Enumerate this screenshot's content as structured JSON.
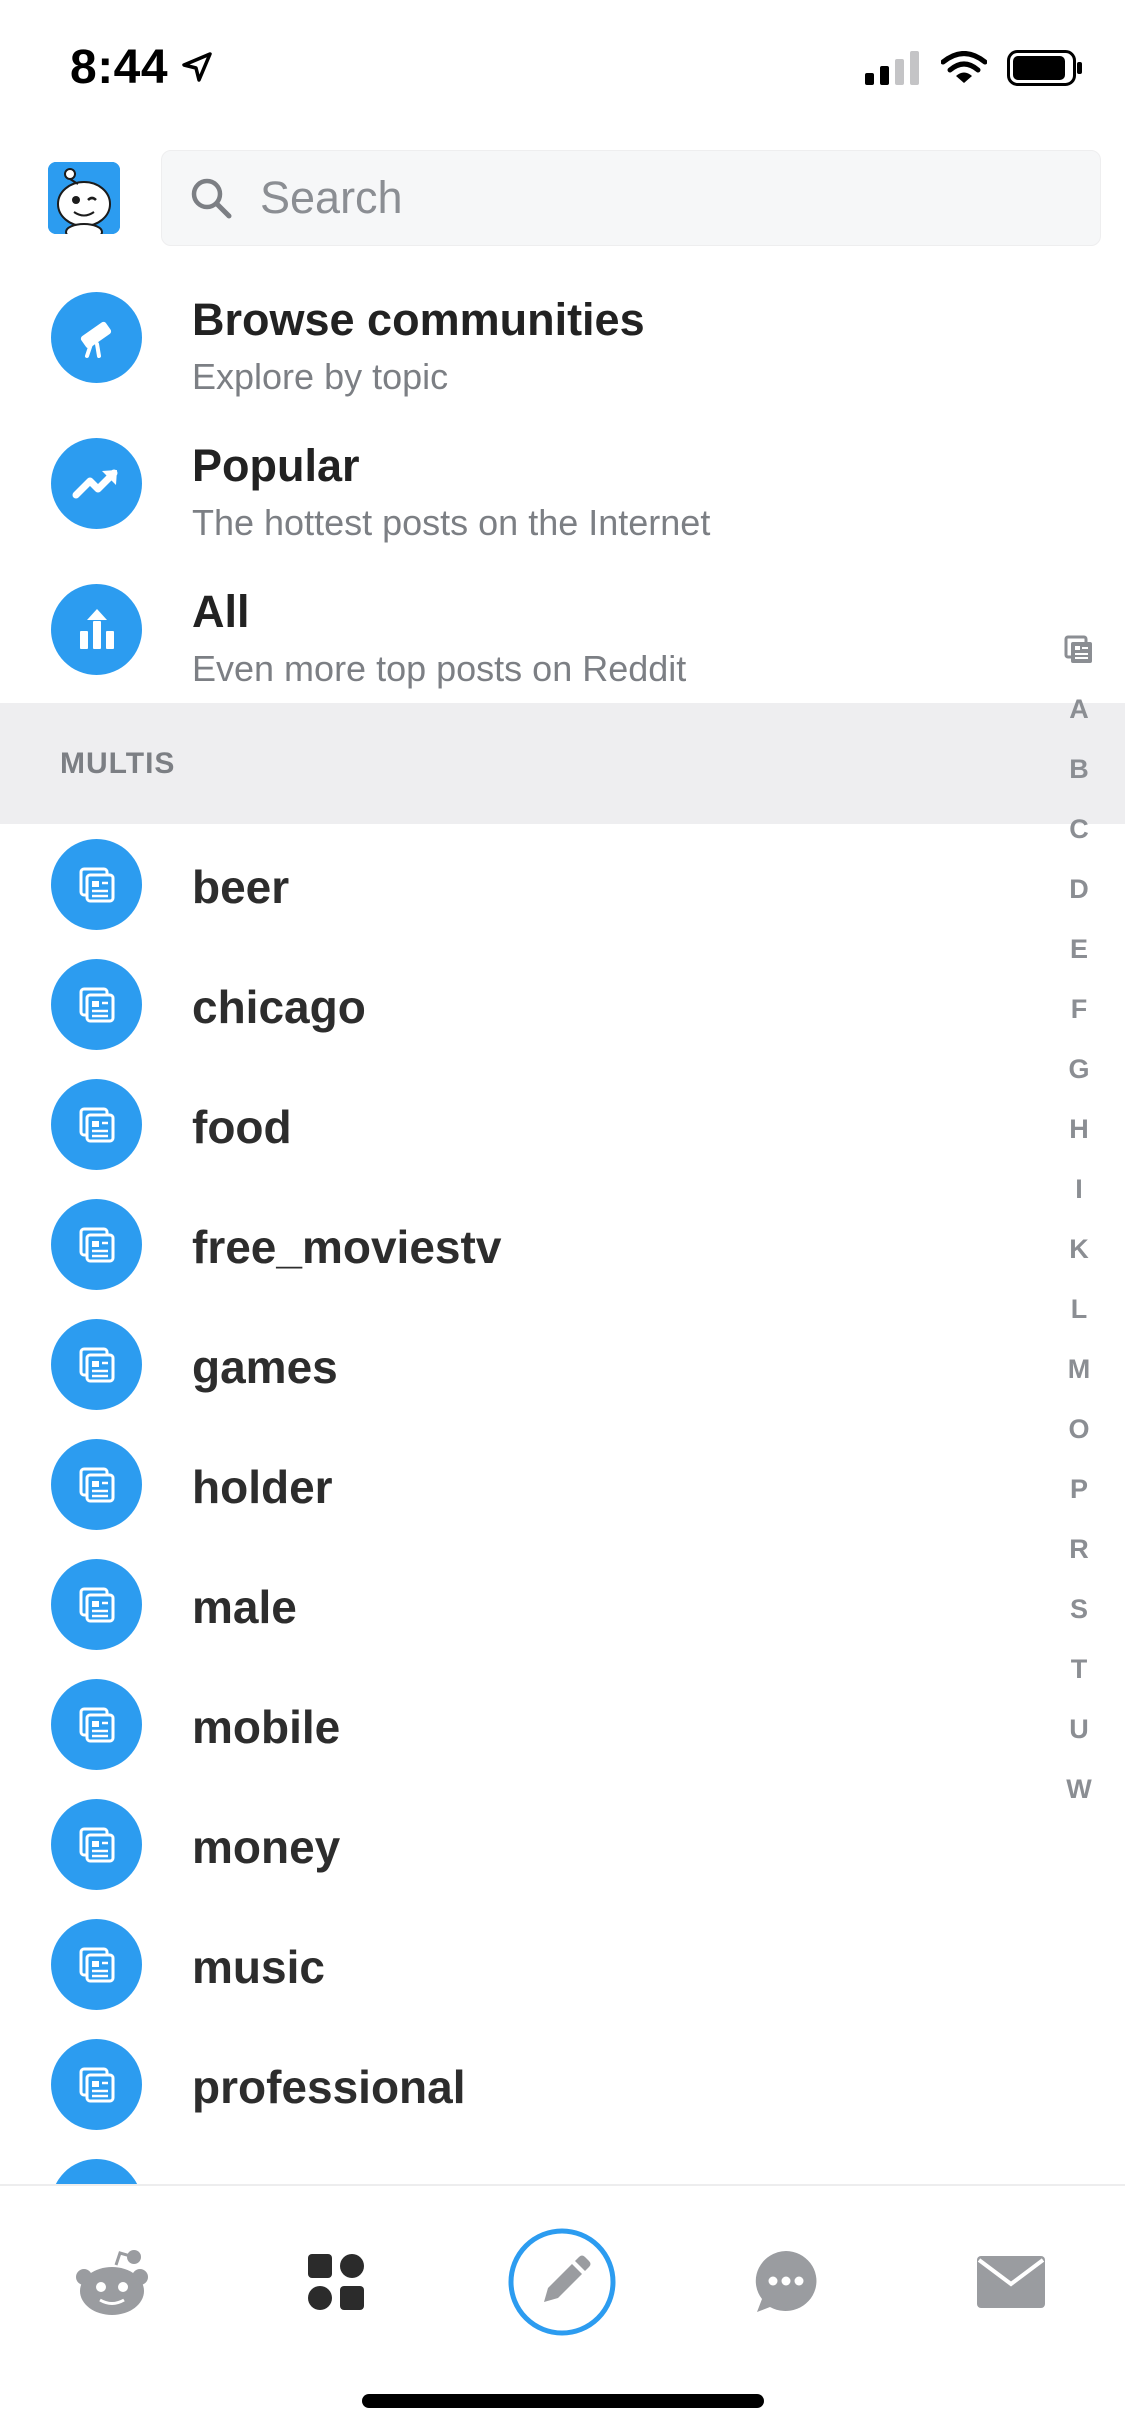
{
  "status_bar": {
    "time": "8:44"
  },
  "search": {
    "placeholder": "Search"
  },
  "feeds": [
    {
      "title": "Browse communities",
      "subtitle": "Explore by topic",
      "icon": "telescope-icon"
    },
    {
      "title": "Popular",
      "subtitle": "The hottest posts on the Internet",
      "icon": "trending-up-icon"
    },
    {
      "title": "All",
      "subtitle": "Even more top posts on Reddit",
      "icon": "bar-chart-up-icon"
    }
  ],
  "section": {
    "label": "MULTIS"
  },
  "multis": [
    {
      "label": "beer"
    },
    {
      "label": "chicago"
    },
    {
      "label": "food"
    },
    {
      "label": "free_moviestv"
    },
    {
      "label": "games"
    },
    {
      "label": "holder"
    },
    {
      "label": "male"
    },
    {
      "label": "mobile"
    },
    {
      "label": "money"
    },
    {
      "label": "music"
    },
    {
      "label": "professional"
    }
  ],
  "alpha_index": [
    "A",
    "B",
    "C",
    "D",
    "E",
    "F",
    "G",
    "H",
    "I",
    "K",
    "L",
    "M",
    "O",
    "P",
    "R",
    "S",
    "T",
    "U",
    "W"
  ],
  "tab_bar": {
    "tabs": [
      "home-icon",
      "communities-icon",
      "create-post-icon",
      "chat-icon",
      "inbox-icon"
    ],
    "accent": "#2c9cf0",
    "icon_gray": "#9a9ca0",
    "active_dark": "#2b2b2b"
  },
  "colors": {
    "accent": "#2c9cf0",
    "section_bg": "#eeeef0",
    "muted_text": "#7c7f84"
  }
}
